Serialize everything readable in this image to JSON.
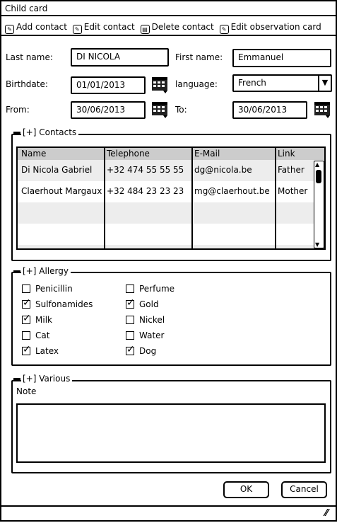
{
  "window": {
    "title": "Child card"
  },
  "toolbar": [
    {
      "label": "Add contact",
      "icon": "pencil-icon"
    },
    {
      "label": "Edit contact",
      "icon": "pencil-icon"
    },
    {
      "label": "Delete contact",
      "icon": "trash-icon"
    },
    {
      "label": "Edit observation card",
      "icon": "pencil-icon"
    }
  ],
  "form": {
    "last_name_label": "Last name:",
    "last_name": "DI NICOLA",
    "first_name_label": "First name:",
    "first_name": "Emmanuel",
    "birthdate_label": "Birthdate:",
    "birthdate": "01/01/2013",
    "language_label": "language:",
    "language": "French",
    "from_label": "From:",
    "from": "30/06/2013",
    "to_label": "To:",
    "to": "30/06/2013"
  },
  "contacts": {
    "legend": "[+] Contacts",
    "columns": [
      "Name",
      "Telephone",
      "E-Mail",
      "Link"
    ],
    "rows": [
      [
        "Di Nicola Gabriel",
        "+32 474 55 55 55",
        "dg@nicola.be",
        "Father"
      ],
      [
        "Claerhout Margaux",
        "+32 484 23 23 23",
        "mg@claerhout.be",
        "Mother"
      ]
    ]
  },
  "allergy": {
    "legend": "[+] Allergy",
    "items": [
      {
        "label": "Penicillin",
        "checked": false
      },
      {
        "label": "Sulfonamides",
        "checked": true
      },
      {
        "label": "Milk",
        "checked": true
      },
      {
        "label": "Cat",
        "checked": false
      },
      {
        "label": "Latex",
        "checked": true
      },
      {
        "label": "Perfume",
        "checked": false
      },
      {
        "label": "Gold",
        "checked": true
      },
      {
        "label": "Nickel",
        "checked": false
      },
      {
        "label": "Water",
        "checked": false
      },
      {
        "label": "Dog",
        "checked": true
      }
    ]
  },
  "various": {
    "legend": "[+] Various",
    "note_label": "Note",
    "note": ""
  },
  "buttons": {
    "ok": "OK",
    "cancel": "Cancel"
  }
}
